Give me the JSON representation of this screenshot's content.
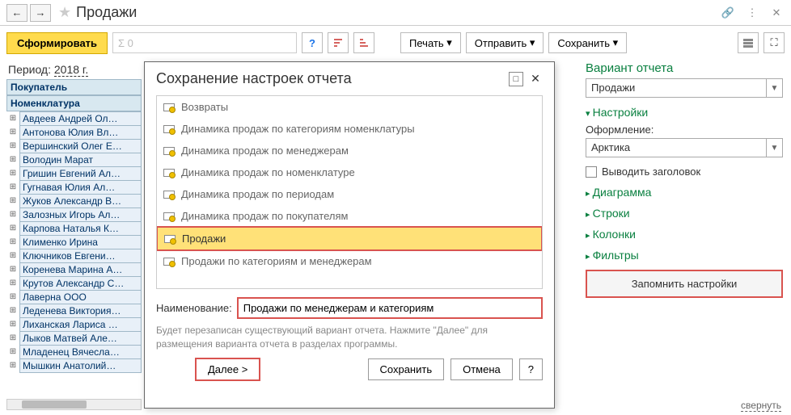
{
  "header": {
    "title": "Продажи"
  },
  "toolbar": {
    "form_label": "Сформировать",
    "filter_placeholder": "Σ 0",
    "print_label": "Печать",
    "send_label": "Отправить",
    "save_label": "Сохранить"
  },
  "period": {
    "label": "Период:",
    "value": "2018 г."
  },
  "table": {
    "headers": [
      "Покупатель",
      "Номенклатура"
    ],
    "rows": [
      "Авдеев Андрей Ол…",
      "Антонова Юлия Вл…",
      "Вершинский Олег Е…",
      "Володин Марат",
      "Гришин Евгений Ал…",
      "Гугнавая Юлия Ал…",
      "Жуков Александр В…",
      "Залозных Игорь Ал…",
      "Карпова Наталья К…",
      "Клименко Ирина",
      "Ключников Евгени…",
      "Коренева Марина А…",
      "Крутов Александр С…",
      "Лаверна ООО",
      "Леденева Виктория…",
      "Лиханская Лариса …",
      "Лыков Матвей Але…",
      "Младенец Вячесла…",
      "Мышкин Анатолий…"
    ]
  },
  "dialog": {
    "title": "Сохранение настроек отчета",
    "items": [
      "Возвраты",
      "Динамика продаж по категориям номенклатуры",
      "Динамика продаж по менеджерам",
      "Динамика продаж по номенклатуре",
      "Динамика продаж по периодам",
      "Динамика продаж по покупателям",
      "Продажи",
      "Продажи по категориям и менеджерам"
    ],
    "selected_index": 6,
    "name_label": "Наименование:",
    "name_value": "Продажи по менеджерам и категориям",
    "hint": "Будет перезаписан существующий вариант отчета.\nНажмите \"Далее\" для размещения варианта отчета в разделах программы.",
    "next_label": "Далее  >",
    "save_label": "Сохранить",
    "cancel_label": "Отмена",
    "help_label": "?"
  },
  "side": {
    "group_title": "Вариант отчета",
    "variant_value": "Продажи",
    "settings_label": "Настройки",
    "design_label": "Оформление:",
    "design_value": "Арктика",
    "show_title_label": "Выводить заголовок",
    "sections": [
      "Диаграмма",
      "Строки",
      "Колонки",
      "Фильтры"
    ],
    "remember_label": "Запомнить настройки",
    "collapse_label": "свернуть"
  }
}
